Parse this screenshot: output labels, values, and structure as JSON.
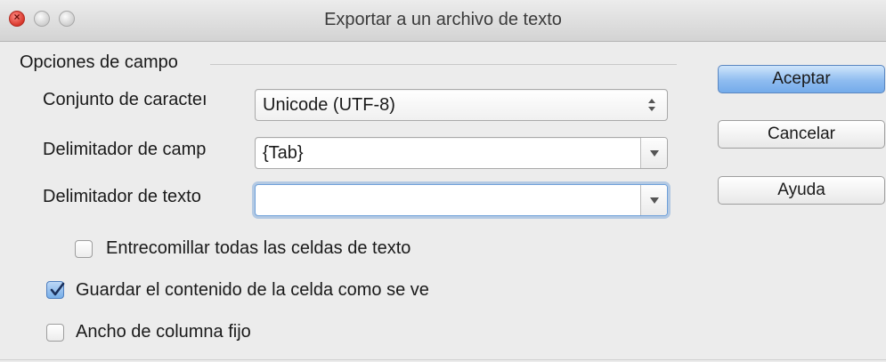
{
  "window": {
    "title": "Exportar a un archivo de texto"
  },
  "section": {
    "label": "Opciones de campo"
  },
  "fields": {
    "charset_label": "Conjunto de caracteı",
    "charset_value": "Unicode (UTF-8)",
    "field_delim_label": "Delimitador de camp",
    "field_delim_value": "{Tab}",
    "text_delim_label": "Delimitador de texto",
    "text_delim_value": ""
  },
  "options": {
    "quote_all_label": "Entrecomillar todas las celdas de texto",
    "quote_all_checked": false,
    "save_as_shown_label": "Guardar el contenido de la celda como se ve",
    "save_as_shown_checked": true,
    "fixed_width_label": "Ancho de columna fijo",
    "fixed_width_checked": false
  },
  "buttons": {
    "ok_label": "Aceptar",
    "cancel_label": "Cancelar",
    "help_label": "Ayuda"
  },
  "colors": {
    "accent": "#74abea",
    "close_light": "#d8372b",
    "focus_ring": "#6ea0d9"
  }
}
